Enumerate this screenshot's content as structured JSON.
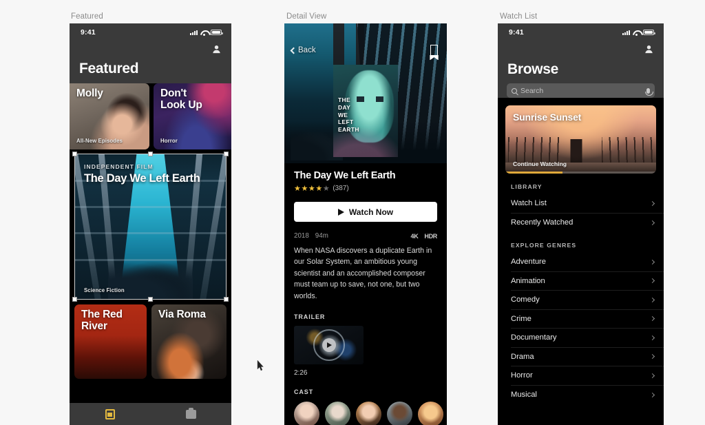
{
  "panels": {
    "featured_label": "Featured",
    "detail_label": "Detail View",
    "watchlist_label": "Watch List"
  },
  "status_bar": {
    "time": "9:41",
    "signal_icon": "cellular-bars-icon",
    "wifi_icon": "wifi-icon",
    "battery_icon": "battery-icon"
  },
  "featured": {
    "profile_icon": "profile-avatar-icon",
    "title": "Featured",
    "tiles": [
      {
        "title": "Molly",
        "subtitle": "All-New Episodes"
      },
      {
        "title": "Don't\nLook Up",
        "subtitle": "Horror"
      }
    ],
    "hero": {
      "tag": "INDEPENDENT FILM",
      "title": "The Day We Left Earth",
      "subtitle": "Science Fiction",
      "selected": true
    },
    "tiles2": [
      {
        "title": "The Red River",
        "subtitle": ""
      },
      {
        "title": "Via Roma",
        "subtitle": ""
      }
    ],
    "tabbar": [
      {
        "icon": "library-tab-icon",
        "active": true
      },
      {
        "icon": "store-tab-icon",
        "active": false
      }
    ]
  },
  "detail": {
    "back_label": "Back",
    "bookmark_icon": "bookmark-icon",
    "poster_text": "THE\nDAY\nWE\nLEFT\nEARTH",
    "title": "The Day We Left Earth",
    "rating_filled": 4,
    "rating_total": 5,
    "rating_stars": "★★★★",
    "rating_star_off": "★",
    "review_count": "(387)",
    "watch_button": "Watch Now",
    "year": "2018",
    "runtime": "94m",
    "badge_4k": "4K",
    "badge_hdr": "HDR",
    "synopsis": "When NASA discovers a duplicate Earth in our Solar System, an ambitious young scientist and an accomplished composer must team up to save, not one, but two worlds.",
    "trailer_heading": "TRAILER",
    "trailer_duration": "2:26",
    "cast_heading": "CAST",
    "cast_count": 5
  },
  "browse": {
    "profile_icon": "profile-avatar-icon",
    "title": "Browse",
    "search_placeholder": "Search",
    "search_icon": "search-icon",
    "mic_icon": "microphone-icon",
    "continue_card": {
      "title": "Sunrise Sunset",
      "subtitle": "Continue Watching",
      "progress_percent": 38,
      "progress_color": "#e0a93a"
    },
    "sections": [
      {
        "heading": "LIBRARY",
        "items": [
          {
            "label": "Watch List"
          },
          {
            "label": "Recently Watched"
          }
        ]
      },
      {
        "heading": "EXPLORE GENRES",
        "items": [
          {
            "label": "Adventure"
          },
          {
            "label": "Animation"
          },
          {
            "label": "Comedy"
          },
          {
            "label": "Crime"
          },
          {
            "label": "Documentary"
          },
          {
            "label": "Drama"
          },
          {
            "label": "Horror"
          },
          {
            "label": "Musical"
          }
        ]
      }
    ]
  },
  "colors": {
    "background": "#f7f7f7",
    "chrome": "#3a3a3a",
    "screen": "#000000",
    "accent_yellow": "#e3b93f",
    "star": "#f3c23c"
  }
}
